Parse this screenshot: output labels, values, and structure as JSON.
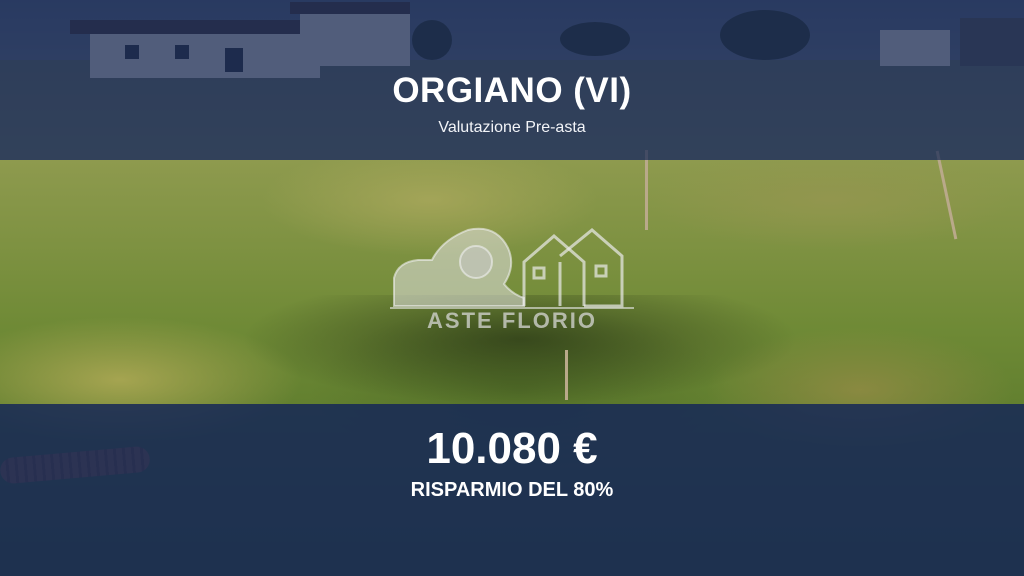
{
  "listing": {
    "location": "ORGIANO (VI)",
    "subtitle": "Valutazione Pre-asta",
    "price": "10.080 €",
    "savings": "RISPARMIO DEL 80%"
  },
  "watermark": {
    "brand": "ASTE FLORIO",
    "icon": "lion-houses-logo"
  },
  "colors": {
    "overlay": "#162856",
    "text": "#ffffff"
  }
}
